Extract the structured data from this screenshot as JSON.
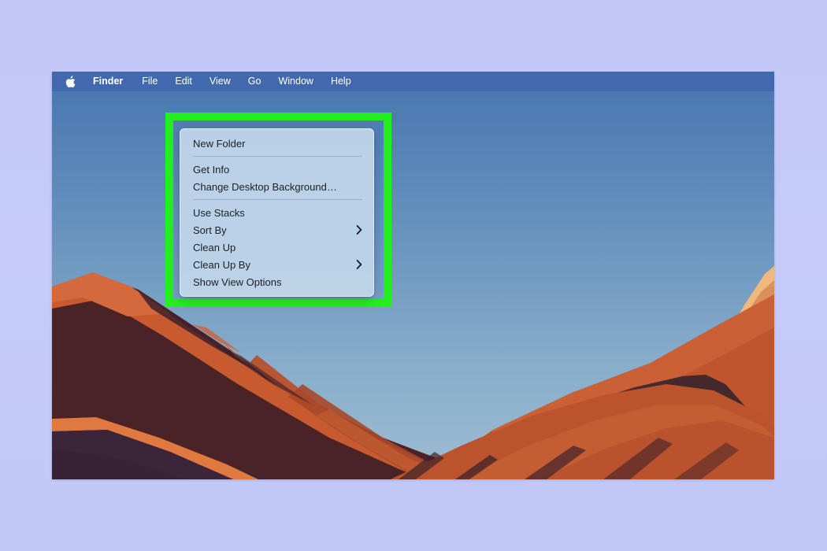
{
  "menubar": {
    "apple_icon": "apple-logo-icon",
    "items": [
      {
        "label": "Finder",
        "bold": true
      },
      {
        "label": "File",
        "bold": false
      },
      {
        "label": "Edit",
        "bold": false
      },
      {
        "label": "View",
        "bold": false
      },
      {
        "label": "Go",
        "bold": false
      },
      {
        "label": "Window",
        "bold": false
      },
      {
        "label": "Help",
        "bold": false
      }
    ],
    "background_color": "#4269ad",
    "text_color": "#ffffff"
  },
  "context_menu": {
    "background_color": "#bdd4e8",
    "text_color": "#1d1f24",
    "groups": [
      {
        "items": [
          {
            "label": "New Folder",
            "submenu": false
          }
        ]
      },
      {
        "items": [
          {
            "label": "Get Info",
            "submenu": false
          },
          {
            "label": "Change Desktop Background…",
            "submenu": false
          }
        ]
      },
      {
        "items": [
          {
            "label": "Use Stacks",
            "submenu": false
          },
          {
            "label": "Sort By",
            "submenu": true
          },
          {
            "label": "Clean Up",
            "submenu": false
          },
          {
            "label": "Clean Up By",
            "submenu": true
          },
          {
            "label": "Show View Options",
            "submenu": false
          }
        ]
      }
    ]
  },
  "highlight": {
    "color": "#25ef1f",
    "thickness_px": 10
  },
  "wallpaper": {
    "name": "big-sur-desert-mountains",
    "sky_top_color": "#4f7fb5",
    "sky_bottom_color": "#93b6d2",
    "ridge_orange": "#c5552c",
    "ridge_light_orange": "#d4663a",
    "ridge_dark": "#4a2327",
    "ridge_deep_shadow": "#3a2230",
    "sun_peak_color": "#e8a86a"
  },
  "page": {
    "background_color": "#c3c8f8"
  }
}
